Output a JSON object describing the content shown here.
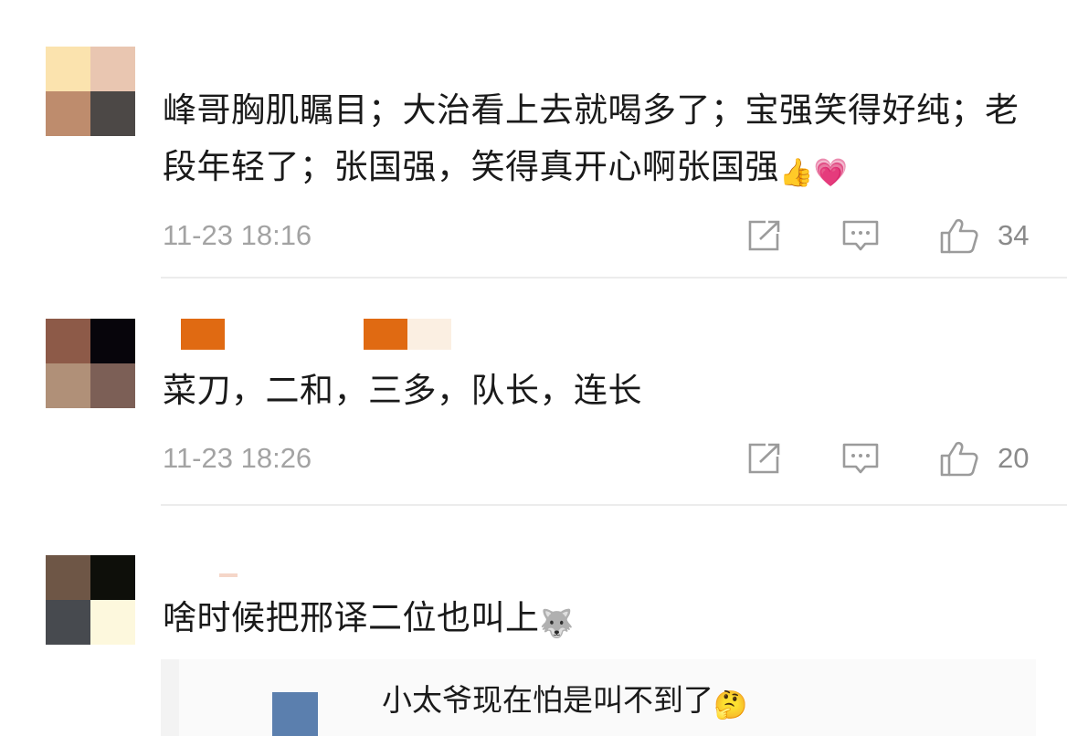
{
  "comments": [
    {
      "avatar_colors": [
        "#fbe3ae",
        "#e9c6b1",
        "#be8c6d",
        "#4c4846"
      ],
      "username_colors": [],
      "text": "峰哥胸肌瞩目；大治看上去就喝多了；宝强笑得好纯；老段年轻了；张国强，笑得真开心啊张国强",
      "emojis": [
        "👍",
        "💗"
      ],
      "timestamp": "11-23 18:16",
      "like_count": "34"
    },
    {
      "avatar_colors": [
        "#8d5a48",
        "#07050b",
        "#b09078",
        "#7c5f56"
      ],
      "username_colors": [
        "#e06a12",
        "#e06a12",
        "#fbefe2"
      ],
      "text": "菜刀，二和，三多，队长，连长",
      "emojis": [],
      "timestamp": "11-23 18:26",
      "like_count": "20"
    },
    {
      "avatar_colors": [
        "#6e5646",
        "#0e0f0a",
        "#474a4f",
        "#fdf8dd"
      ],
      "username_colors": [
        "#f5d6c8"
      ],
      "text": "啥时候把邢译二位也叫上",
      "emojis": [
        "🐺"
      ],
      "timestamp": "",
      "like_count": ""
    }
  ],
  "reply": {
    "text": "小太爷现在怕是叫不到了",
    "emoji": "🤔"
  },
  "icons": {
    "share": "share-icon",
    "comment": "comment-icon",
    "like": "thumbs-up-icon"
  },
  "colors": {
    "text": "#1a1a1a",
    "meta": "#a3a3a3",
    "icon": "#9b9b9b",
    "divider": "#ececec"
  }
}
